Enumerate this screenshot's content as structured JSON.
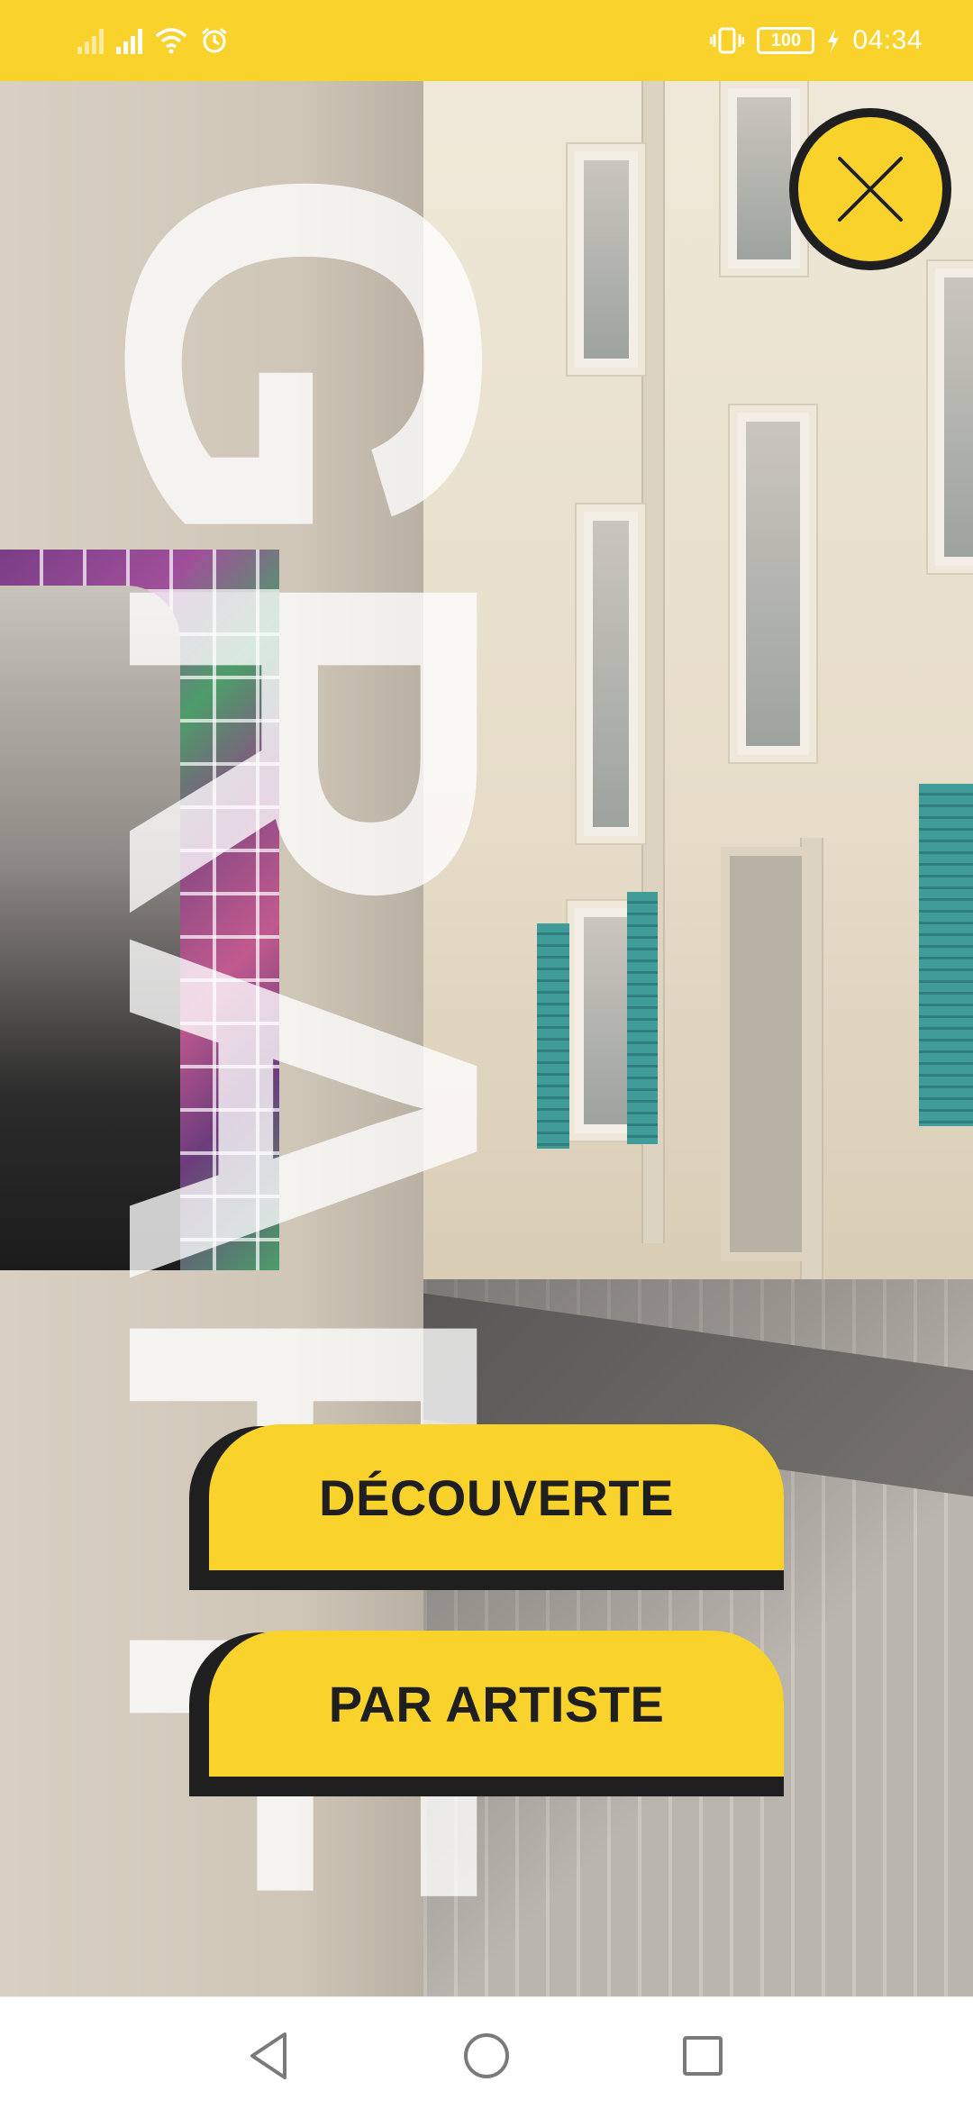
{
  "status_bar": {
    "time": "04:34",
    "battery": "100"
  },
  "hero": {
    "vertical_title": "GRAFF"
  },
  "menu": {
    "discovery_label": "DÉCOUVERTE",
    "artist_label": "PAR ARTISTE"
  },
  "colors": {
    "accent": "#f9d22b",
    "dark": "#1f1f1f"
  },
  "icons": {
    "close": "close-icon",
    "back": "back-icon",
    "home": "home-icon",
    "recents": "recents-icon"
  }
}
